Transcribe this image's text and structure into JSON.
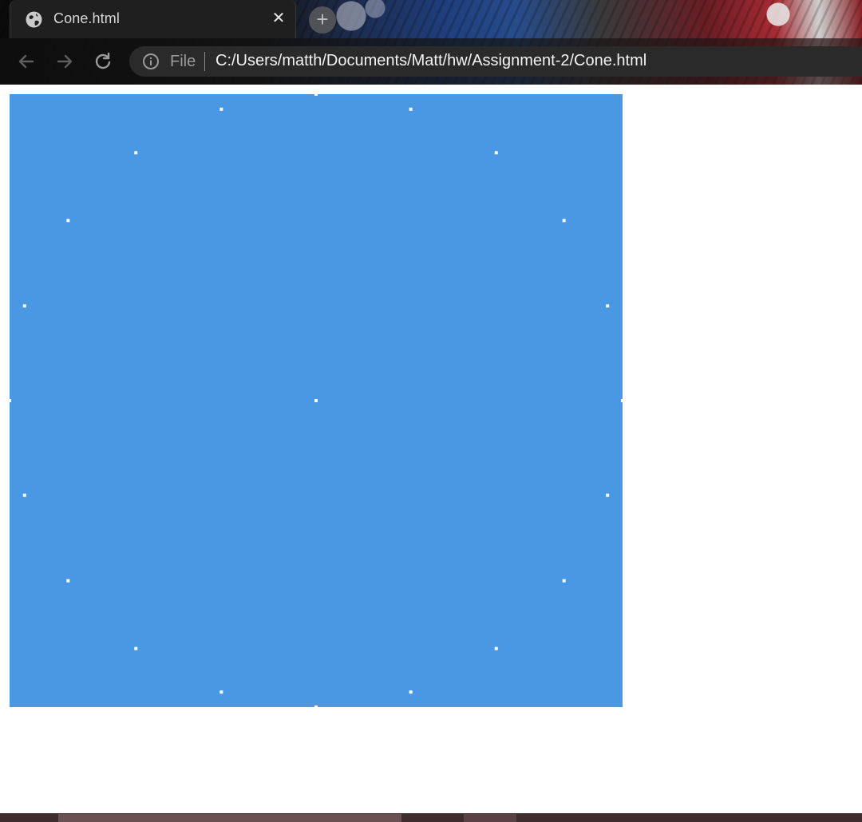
{
  "browser": {
    "tab": {
      "title": "Cone.html",
      "icon": "globe-icon",
      "close_glyph": "✕"
    },
    "new_tab_glyph": "+",
    "toolbar": {
      "back_icon": "back-arrow-icon",
      "forward_icon": "forward-arrow-icon",
      "reload_icon": "reload-icon"
    },
    "address_bar": {
      "info_icon": "info-icon",
      "scheme_label": "File",
      "url": "C:/Users/matth/Documents/Matt/hw/Assignment-2/Cone.html"
    }
  },
  "page": {
    "canvas": {
      "background_color": "#4a98e3",
      "point_color": "#ffffff",
      "description_points": {
        "center": [
          0,
          0
        ],
        "circle_radius": 1.0,
        "circle_point_count": 20
      }
    }
  },
  "colors": {
    "chrome_dark": "#1f1f1f",
    "omnibox_bg": "#2a2a2a",
    "url_text": "#f2f2f2",
    "canvas_blue": "#4a98e3"
  }
}
